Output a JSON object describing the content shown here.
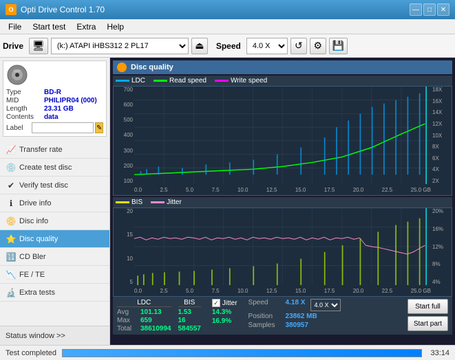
{
  "app": {
    "title": "Opti Drive Control 1.70",
    "min_btn": "—",
    "max_btn": "□",
    "close_btn": "✕"
  },
  "menu": {
    "items": [
      "File",
      "Start test",
      "Extra",
      "Help"
    ]
  },
  "toolbar": {
    "drive_label": "Drive",
    "drive_value": "(k:) ATAPI iHBS312  2 PL17",
    "speed_label": "Speed",
    "speed_value": "4.0 X"
  },
  "disc": {
    "type_key": "Type",
    "type_val": "BD-R",
    "mid_key": "MID",
    "mid_val": "PHILIPR04 (000)",
    "length_key": "Length",
    "length_val": "23.31 GB",
    "contents_key": "Contents",
    "contents_val": "data",
    "label_key": "Label",
    "label_val": ""
  },
  "nav": {
    "items": [
      {
        "id": "transfer-rate",
        "label": "Transfer rate",
        "icon": "📈"
      },
      {
        "id": "create-test-disc",
        "label": "Create test disc",
        "icon": "💿"
      },
      {
        "id": "verify-test-disc",
        "label": "Verify test disc",
        "icon": "✔"
      },
      {
        "id": "drive-info",
        "label": "Drive info",
        "icon": "ℹ"
      },
      {
        "id": "disc-info",
        "label": "Disc info",
        "icon": "📀"
      },
      {
        "id": "disc-quality",
        "label": "Disc quality",
        "icon": "⭐",
        "active": true
      },
      {
        "id": "cd-bler",
        "label": "CD Bler",
        "icon": "🔢"
      },
      {
        "id": "fe-te",
        "label": "FE / TE",
        "icon": "📉"
      },
      {
        "id": "extra-tests",
        "label": "Extra tests",
        "icon": "🔬"
      }
    ],
    "status_window": "Status window >>"
  },
  "chart": {
    "title": "Disc quality",
    "legend_upper": [
      {
        "label": "LDC",
        "color": "#00aaff"
      },
      {
        "label": "Read speed",
        "color": "#00ff00"
      },
      {
        "label": "Write speed",
        "color": "#ff00ff"
      }
    ],
    "legend_lower": [
      {
        "label": "BIS",
        "color": "#ffdd00"
      },
      {
        "label": "Jitter",
        "color": "#ff88cc"
      }
    ],
    "upper_y_left": [
      "700",
      "600",
      "500",
      "400",
      "300",
      "200",
      "100"
    ],
    "upper_y_right": [
      "18X",
      "16X",
      "14X",
      "12X",
      "10X",
      "8X",
      "6X",
      "4X",
      "2X"
    ],
    "lower_y_left": [
      "20",
      "15",
      "10",
      "5"
    ],
    "lower_y_right": [
      "20%",
      "16%",
      "12%",
      "8%",
      "4%"
    ],
    "x_labels": [
      "0.0",
      "2.5",
      "5.0",
      "7.5",
      "10.0",
      "12.5",
      "15.0",
      "17.5",
      "20.0",
      "22.5",
      "25.0 GB"
    ]
  },
  "stats": {
    "ldc_header": "LDC",
    "bis_header": "BIS",
    "jitter_header": "Jitter",
    "rows": [
      {
        "key": "Avg",
        "ldc": "101.13",
        "bis": "1.53",
        "jitter": "14.3%"
      },
      {
        "key": "Max",
        "ldc": "659",
        "bis": "16",
        "jitter": "16.9%"
      },
      {
        "key": "Total",
        "ldc": "38610994",
        "bis": "584557",
        "jitter": ""
      }
    ],
    "jitter_checked": true,
    "speed_label": "Speed",
    "speed_val": "4.18 X",
    "speed_select": "4.0 X",
    "position_label": "Position",
    "position_val": "23862 MB",
    "samples_label": "Samples",
    "samples_val": "380957",
    "start_full": "Start full",
    "start_part": "Start part"
  },
  "bottom": {
    "status": "Test completed",
    "progress": 100,
    "time": "33:14"
  }
}
